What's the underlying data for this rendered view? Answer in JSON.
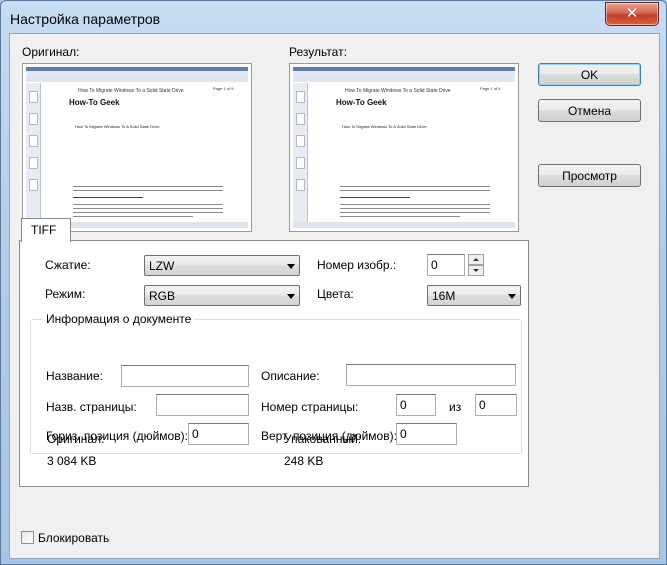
{
  "window": {
    "title": "Настройка параметров",
    "close_glyph": "✕"
  },
  "previews": {
    "original_label": "Оригинал:",
    "result_label": "Результат:",
    "doc_heading": "How-To Geek",
    "doc_header_text": "How To Migrate Windows To a Solid State Drive",
    "doc_subheading": "How To Migrate Windows To A Solid State Drive",
    "page_indicator": "Page 1 of 5"
  },
  "buttons": {
    "ok": "OK",
    "cancel": "Отмена",
    "preview": "Просмотр"
  },
  "tab": {
    "label": "TIFF"
  },
  "settings": {
    "compression_label": "Сжатие:",
    "compression_value": "LZW",
    "mode_label": "Режим:",
    "mode_value": "RGB",
    "image_number_label": "Номер изобр.:",
    "image_number_value": "0",
    "colors_label": "Цвета:",
    "colors_value": "16M"
  },
  "doc_info": {
    "group_title": "Информация о документе",
    "name_label": "Название:",
    "name_value": "",
    "description_label": "Описание:",
    "description_value": "",
    "page_name_label": "Назв. страницы:",
    "page_name_value": "",
    "page_number_label": "Номер страницы:",
    "page_number_value": "0",
    "of_label": "из",
    "page_total_value": "0",
    "hpos_label": "Гориз. позиция (дюймов):",
    "hpos_value": "0",
    "vpos_label": "Верт. позиция (дюймов):",
    "vpos_value": "0"
  },
  "sizes": {
    "original_label": "Оригинал:",
    "original_value": "3 084 KB",
    "packed_label": "Упакованный:",
    "packed_value": "248 KB"
  },
  "lock": {
    "label": "Блокировать",
    "checked": false
  }
}
